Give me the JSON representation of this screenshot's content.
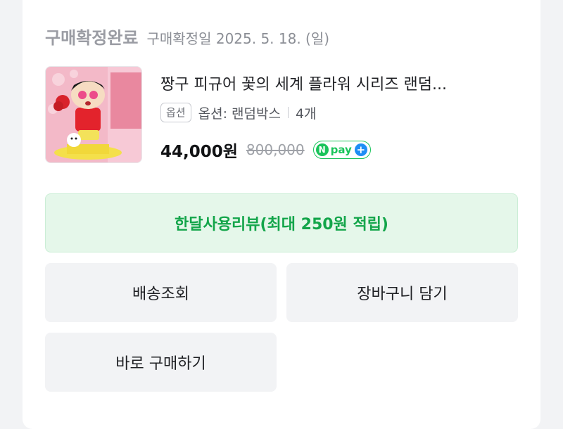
{
  "order": {
    "status_label": "구매확정완료",
    "status_date": "구매확정일 2025. 5. 18. (일)"
  },
  "product": {
    "title": "짱구 피규어 꽃의 세계 플라워 시리즈 랜덤...",
    "option_badge": "옵션",
    "option_text": "옵션: 랜덤박스",
    "quantity": "4개",
    "price": "44,000원",
    "original_price": "800,000",
    "npay": {
      "n": "N",
      "text": "pay",
      "plus": "+"
    }
  },
  "buttons": {
    "review": "한달사용리뷰(최대 250원 적립)",
    "delivery": "배송조회",
    "cart": "장바구니 담기",
    "buy_now": "바로 구매하기"
  },
  "colors": {
    "review_bg": "#e5f7ea",
    "review_text": "#13a54a",
    "npay_green": "#19c45a",
    "npay_blue": "#1e8ef5",
    "button_gray": "#f2f3f5"
  },
  "icons": [
    "product-thumbnail-image",
    "npay-logo-icon",
    "npay-plus-icon"
  ]
}
